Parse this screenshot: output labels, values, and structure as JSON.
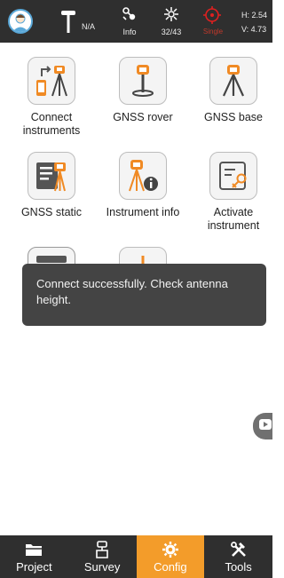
{
  "statusbar": {
    "icons": [
      "user-avatar-icon",
      "rover-pole-icon",
      "satellite-icon",
      "gnss-antenna-icon",
      "fix-status-icon"
    ],
    "na_text": "N/A",
    "info_label": "Info",
    "sat_count": "32/43",
    "fix_label": "Single",
    "h_text": "H: 2.54",
    "v_text": "V: 4.73"
  },
  "grid": {
    "items": [
      {
        "label": "Connect instruments",
        "icon": "connect-instruments-icon"
      },
      {
        "label": "GNSS rover",
        "icon": "gnss-rover-icon"
      },
      {
        "label": "GNSS base",
        "icon": "gnss-base-icon"
      },
      {
        "label": "GNSS static",
        "icon": "gnss-static-icon"
      },
      {
        "label": "Instrument info",
        "icon": "instrument-info-icon"
      },
      {
        "label": "Activate instrument",
        "icon": "activate-instrument-icon"
      }
    ]
  },
  "toast": {
    "message": "Connect successfully. Check antenna height."
  },
  "bottomnav": {
    "items": [
      {
        "label": "Project",
        "icon": "folder-icon"
      },
      {
        "label": "Survey",
        "icon": "survey-icon"
      },
      {
        "label": "Config",
        "icon": "gear-icon"
      },
      {
        "label": "Tools",
        "icon": "tools-icon"
      }
    ],
    "active": "Config"
  },
  "colors": {
    "accent": "#f39c2a",
    "bar_bg": "#2f2f2f",
    "toast_bg": "#444444",
    "fix_red": "#c0392b"
  }
}
